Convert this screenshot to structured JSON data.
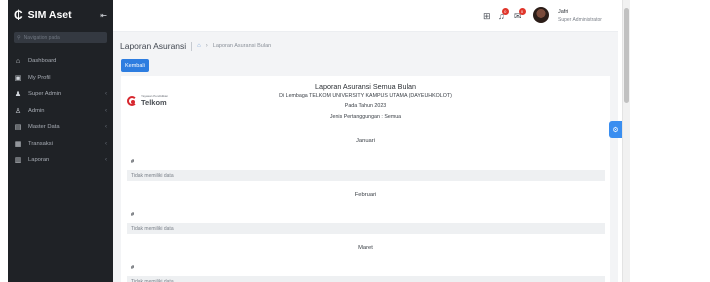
{
  "sidebar": {
    "brand": "SIM Aset",
    "search_placeholder": "Navigation pada",
    "items": [
      {
        "label": "Dashboard",
        "icon": "home-icon"
      },
      {
        "label": "My Profil",
        "icon": "profile-card-icon"
      },
      {
        "label": "Super Admin",
        "icon": "users-icon"
      },
      {
        "label": "Admin",
        "icon": "user-icon"
      },
      {
        "label": "Master Data",
        "icon": "database-icon"
      },
      {
        "label": "Transaksi",
        "icon": "transaction-icon"
      },
      {
        "label": "Laporan",
        "icon": "report-icon"
      }
    ]
  },
  "topbar": {
    "notification_count": "0",
    "message_count": "0",
    "user_name": "Jafri",
    "user_role": "Super Administrator"
  },
  "page": {
    "title": "Laporan Asuransi",
    "breadcrumb_current": "Laporan Asuransi Bulan",
    "back_button": "Kembali"
  },
  "report": {
    "logo_small": "Yayasan Pendidikan",
    "logo_name": "Telkom",
    "title": "Laporan Asuransi Semua Bulan",
    "institution": "Di Lembaga TELKOM UNIVERSITY KAMPUS UTAMA (DAYEUHKOLOT)",
    "year": "Pada Tahun 2023",
    "coverage": "Jenis Pertanggungan : Semua",
    "col_hash": "#",
    "empty_text": "Tidak memiliki data",
    "months": [
      "Januari",
      "Februari",
      "Maret"
    ]
  },
  "colors": {
    "sidebar_bg": "#1f2226",
    "primary": "#2d7de0",
    "badge": "#e0362b",
    "telkom_red": "#d7282f"
  }
}
